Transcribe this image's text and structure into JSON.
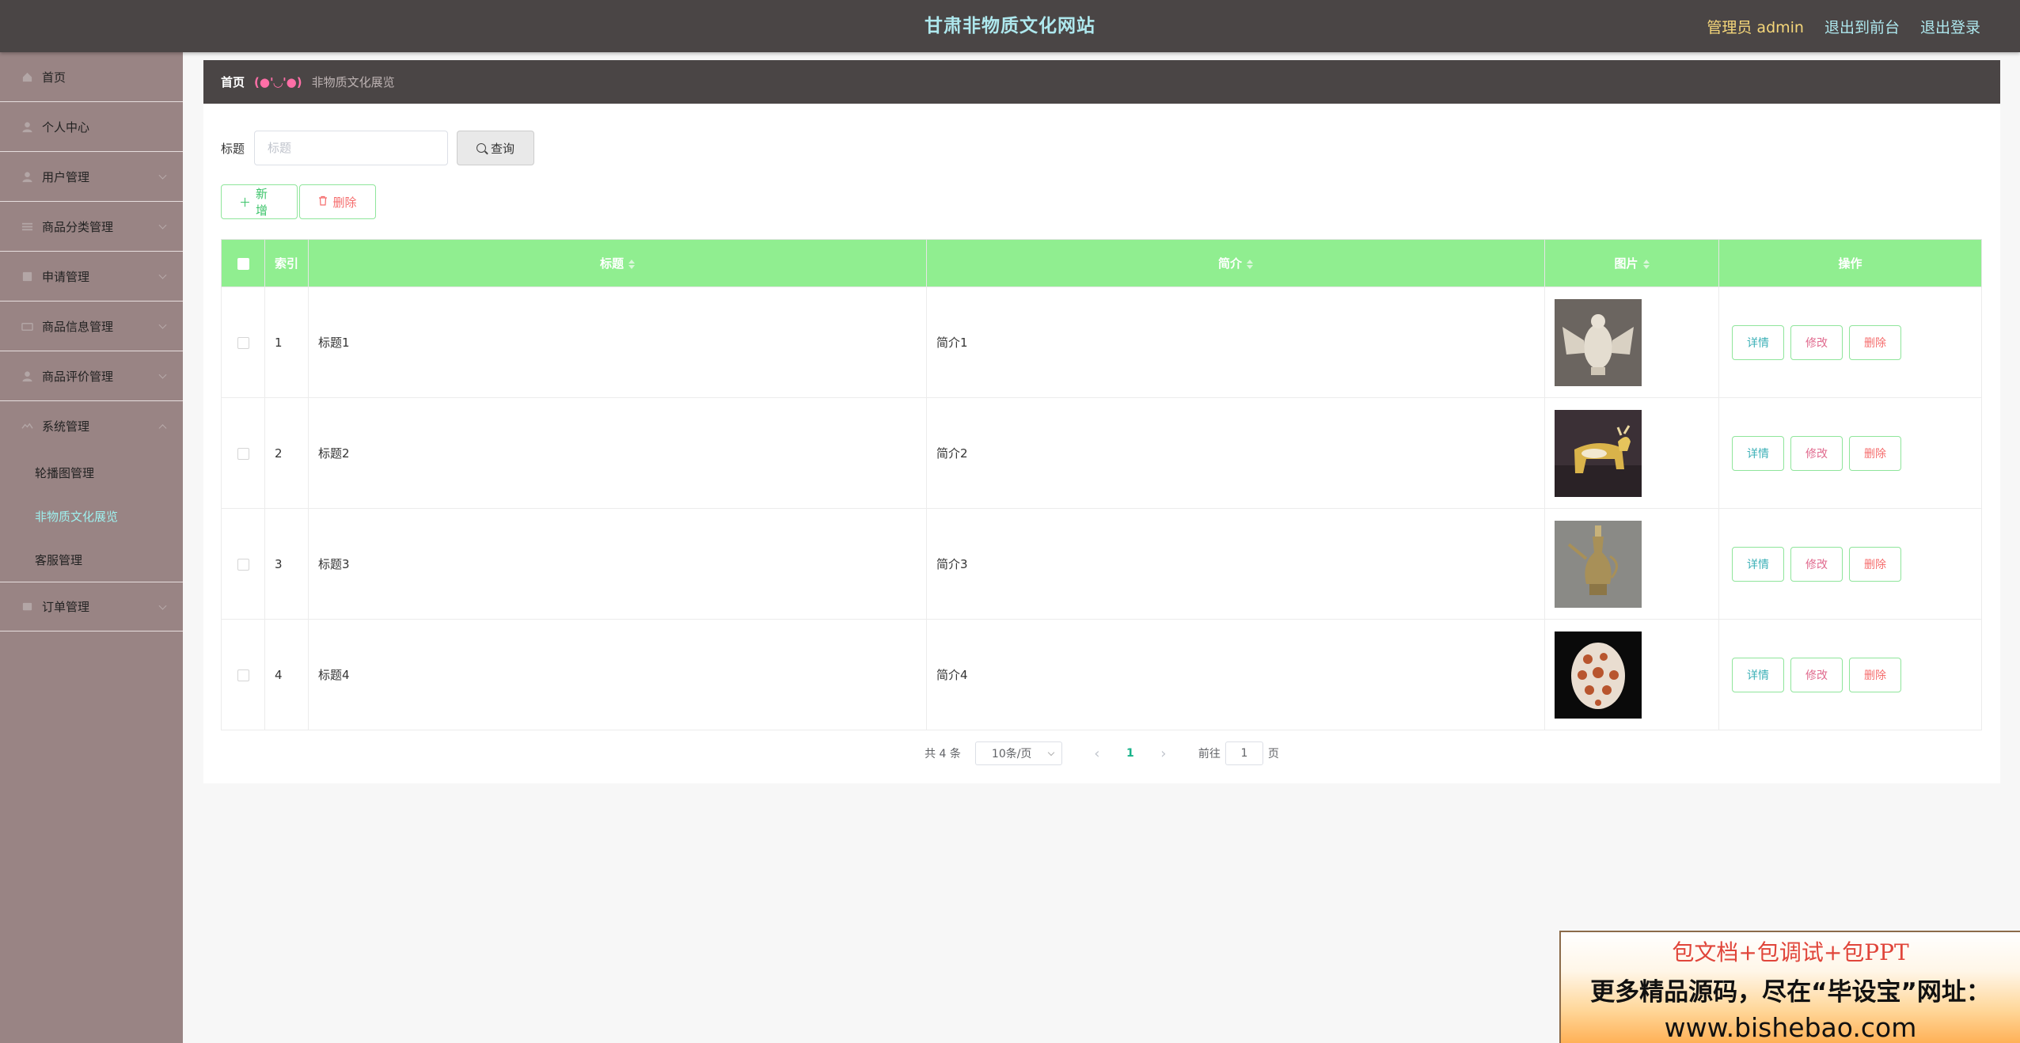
{
  "header": {
    "site_title": "甘肃非物质文化网站",
    "role": "管理员 admin",
    "to_front": "退出到前台",
    "logout": "退出登录"
  },
  "sidebar": {
    "items": [
      {
        "label": "首页",
        "icon": "home-icon"
      },
      {
        "label": "个人中心",
        "icon": "user-icon"
      },
      {
        "label": "用户管理",
        "icon": "user-icon"
      },
      {
        "label": "商品分类管理",
        "icon": "list-icon"
      },
      {
        "label": "申请管理",
        "icon": "document-icon"
      },
      {
        "label": "商品信息管理",
        "icon": "box-icon"
      },
      {
        "label": "商品评价管理",
        "icon": "user-icon"
      },
      {
        "label": "系统管理",
        "icon": "settings-icon"
      }
    ],
    "system_sub": [
      {
        "label": "轮播图管理"
      },
      {
        "label": "非物质文化展览"
      },
      {
        "label": "客服管理"
      }
    ],
    "last_item": {
      "label": "订单管理",
      "icon": "order-icon"
    }
  },
  "breadcrumb": {
    "home": "首页",
    "separator": "(●'◡'●)",
    "current": "非物质文化展览"
  },
  "search": {
    "label": "标题",
    "placeholder": "标题",
    "button": "查询"
  },
  "actions": {
    "add": "新增",
    "delete": "删除"
  },
  "table": {
    "columns": [
      "索引",
      "标题",
      "简介",
      "图片",
      "操作"
    ],
    "rows": [
      {
        "index": "1",
        "title": "标题1",
        "intro": "简介1",
        "image": "white carved jade eagle"
      },
      {
        "index": "2",
        "title": "标题2",
        "intro": "简介2",
        "image": "tricolor glazed ox"
      },
      {
        "index": "3",
        "title": "标题3",
        "intro": "简介3",
        "image": "bronze ewer"
      },
      {
        "index": "4",
        "title": "标题4",
        "intro": "简介4",
        "image": "openwork jade vessel"
      }
    ],
    "op_detail": "详情",
    "op_edit": "修改",
    "op_delete": "删除"
  },
  "pagination": {
    "total": "共 4 条",
    "page_size": "10条/页",
    "current_page": "1",
    "goto_label": "前往",
    "goto_value": "1",
    "page_suffix": "页"
  },
  "ad": {
    "line1": "包文档+包调试+包PPT",
    "line2": "更多精品源码，尽在“毕设宝”网址：",
    "line3": "www.bishebao.com"
  },
  "colors": {
    "header_bg": "#4a4545",
    "sidebar_bg": "#998484",
    "table_header": "#90ee90",
    "accent": "#aee8ee"
  }
}
